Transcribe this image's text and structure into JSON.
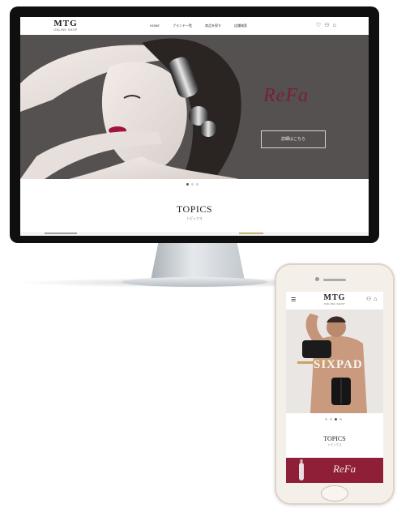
{
  "desktop": {
    "logo": {
      "mark": "MTG",
      "sub": "ONLINE SHOP"
    },
    "nav_items": [
      "HOME",
      "ブランド一覧",
      "商品を探す",
      "店舗検索"
    ],
    "header_icons": [
      "heart-icon",
      "user-icon",
      "cart-icon"
    ],
    "hero": {
      "brand": "ReFa",
      "button_label": "詳細はこちら"
    },
    "slider_dots": 3,
    "slider_active": 0,
    "topics": {
      "title": "TOPICS",
      "subtitle": "トピックス"
    }
  },
  "phone": {
    "logo": {
      "mark": "MTG",
      "sub": "ONLINE SHOP"
    },
    "header_icons": [
      "menu-icon",
      "user-icon",
      "cart-icon"
    ],
    "hero": {
      "brand": "SIXPAD"
    },
    "slider_dots": 4,
    "slider_active": 2,
    "topics": {
      "title": "TOPICS",
      "subtitle": "トピックス"
    },
    "banner": {
      "brand": "ReFa"
    }
  },
  "colors": {
    "accent": "#7b1f33",
    "banner": "#8f1f36",
    "hero_bg": "#545150"
  }
}
